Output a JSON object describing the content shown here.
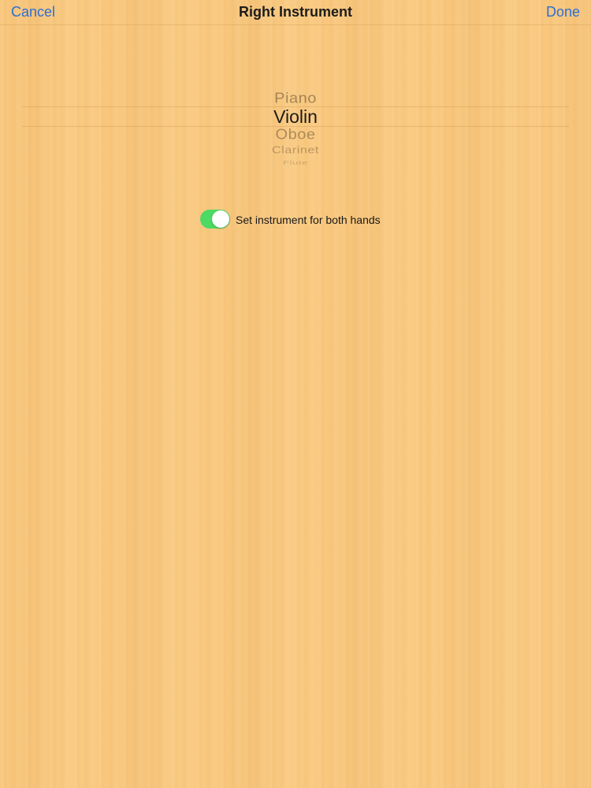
{
  "nav": {
    "title": "Right Instrument",
    "cancel_label": "Cancel",
    "done_label": "Done"
  },
  "picker": {
    "items": [
      "Piano",
      "Violin",
      "Oboe",
      "Clarinet",
      "Flute"
    ],
    "selected": "Violin"
  },
  "toggle": {
    "label": "Set instrument for both hands",
    "on": true,
    "color": "#4cd964"
  },
  "colors": {
    "accent": "#2b6fd6",
    "background": "#f9c87e"
  }
}
